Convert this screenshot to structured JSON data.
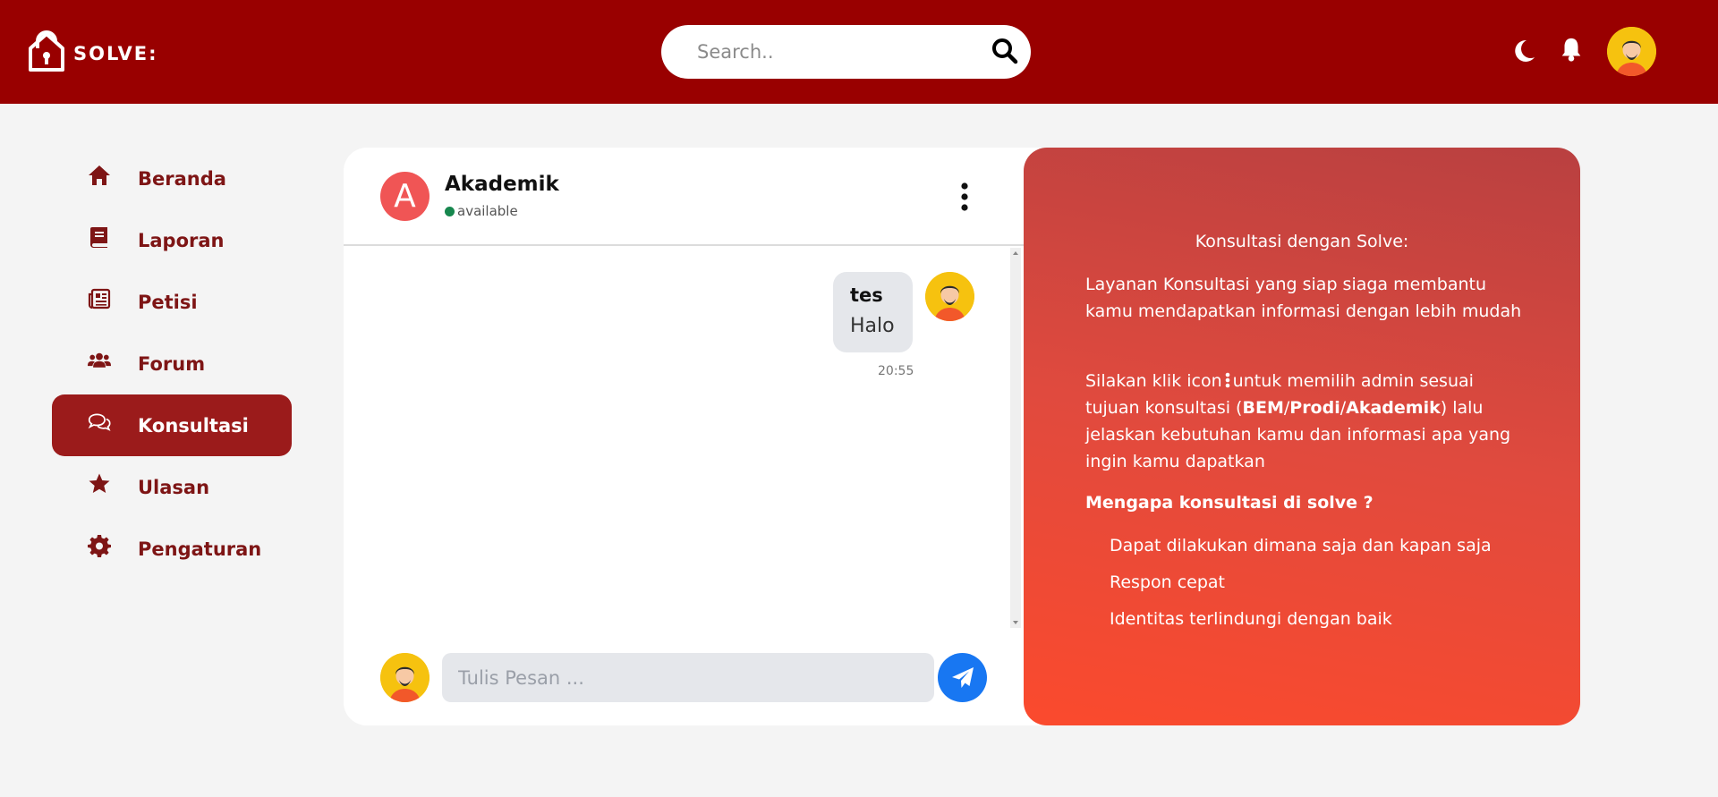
{
  "app": {
    "name": "SOLVE:",
    "accent": "#990000"
  },
  "header": {
    "search_placeholder": "Search..",
    "icons": [
      "moon-icon",
      "bell-icon",
      "user-avatar"
    ]
  },
  "sidebar": {
    "items": [
      {
        "label": "Beranda",
        "icon": "home-icon",
        "active": false
      },
      {
        "label": "Laporan",
        "icon": "book-icon",
        "active": false
      },
      {
        "label": "Petisi",
        "icon": "newspaper-icon",
        "active": false
      },
      {
        "label": "Forum",
        "icon": "users-icon",
        "active": false
      },
      {
        "label": "Konsultasi",
        "icon": "chat-icon",
        "active": true
      },
      {
        "label": "Ulasan",
        "icon": "star-icon",
        "active": false
      },
      {
        "label": "Pengaturan",
        "icon": "gear-icon",
        "active": false
      }
    ]
  },
  "chat": {
    "contact_initial": "A",
    "contact_name": "Akademik",
    "contact_status": "available",
    "messages": [
      {
        "sender": "tes",
        "text": "Halo",
        "time": "20:55"
      }
    ],
    "composer_placeholder": "Tulis Pesan ..."
  },
  "info": {
    "title": "Konsultasi dengan Solve:",
    "intro": "Layanan Konsultasi yang siap siaga membantu kamu mendapatkan informasi dengan lebih mudah",
    "instruction_pre": "Silakan klik icon",
    "instruction_mid": "untuk memilih admin sesuai tujuan konsultasi (",
    "option_bem": "BEM",
    "option_prodi": "Prodi",
    "option_akademik": "Akademik",
    "instruction_post": ") lalu jelaskan kebutuhan kamu dan informasi apa yang ingin kamu dapatkan",
    "why_title": "Mengapa konsultasi di solve ?",
    "reasons": [
      "Dapat dilakukan dimana saja dan kapan saja",
      "Respon cepat",
      "Identitas terlindungi dengan baik"
    ]
  }
}
